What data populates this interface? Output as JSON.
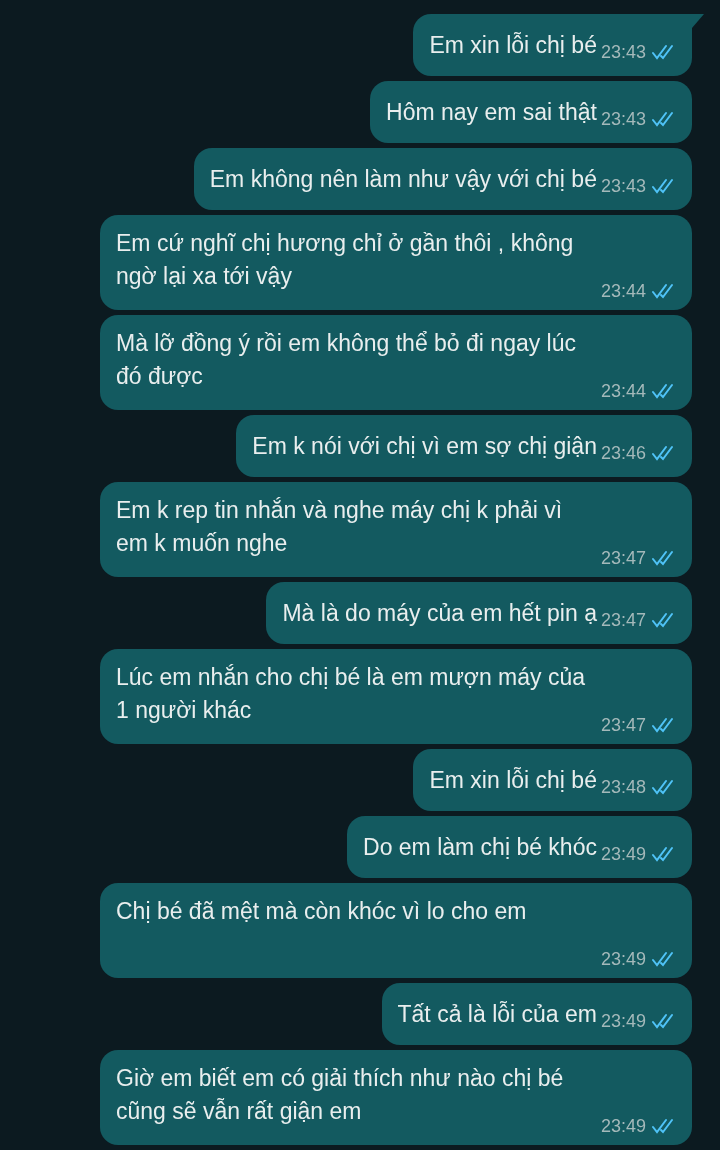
{
  "messages": [
    {
      "kind": "inline",
      "tail": true,
      "lines": [
        "Em xin lỗi chị bé"
      ],
      "time": "23:43",
      "read": true
    },
    {
      "kind": "inline",
      "tail": false,
      "lines": [
        "Hôm nay em sai thật"
      ],
      "time": "23:43",
      "read": true
    },
    {
      "kind": "inline",
      "tail": false,
      "lines": [
        "Em không nên làm như vậy với chị bé"
      ],
      "time": "23:43",
      "read": true
    },
    {
      "kind": "stacked",
      "tail": false,
      "lines": [
        "Em cứ nghĩ chị hương chỉ ở gần thôi , không",
        "ngờ lại xa tới vậy"
      ],
      "time": "23:44",
      "read": true
    },
    {
      "kind": "stacked",
      "tail": false,
      "lines": [
        "Mà lỡ đồng ý rồi em không thể bỏ đi ngay lúc",
        "đó được"
      ],
      "time": "23:44",
      "read": true
    },
    {
      "kind": "inline",
      "tail": false,
      "lines": [
        "Em k nói với chị vì em sợ chị giận"
      ],
      "time": "23:46",
      "read": true
    },
    {
      "kind": "stacked",
      "tail": false,
      "lines": [
        "Em k rep tin nhắn và nghe máy chị k phải vì",
        "em k muốn nghe"
      ],
      "time": "23:47",
      "read": true
    },
    {
      "kind": "inline",
      "tail": false,
      "lines": [
        "Mà là do máy của em hết pin ạ"
      ],
      "time": "23:47",
      "read": true
    },
    {
      "kind": "stacked",
      "tail": false,
      "lines": [
        "Lúc em nhắn cho chị bé là em mượn máy của",
        "1 người khác"
      ],
      "time": "23:47",
      "read": true
    },
    {
      "kind": "inline",
      "tail": false,
      "lines": [
        "Em xin lỗi chị bé"
      ],
      "time": "23:48",
      "read": true
    },
    {
      "kind": "inline",
      "tail": false,
      "lines": [
        "Do em làm chị bé khóc"
      ],
      "time": "23:49",
      "read": true
    },
    {
      "kind": "stacked",
      "tail": false,
      "lines": [
        "Chị bé đã mệt mà còn khóc vì lo cho em"
      ],
      "time": "23:49",
      "read": true
    },
    {
      "kind": "inline",
      "tail": false,
      "lines": [
        "Tất cả là lỗi của em"
      ],
      "time": "23:49",
      "read": true
    },
    {
      "kind": "stacked",
      "tail": false,
      "lines": [
        "Giờ em biết em có giải thích như nào chị bé",
        "cũng sẽ vẫn rất giận em"
      ],
      "time": "23:49",
      "read": true
    }
  ]
}
